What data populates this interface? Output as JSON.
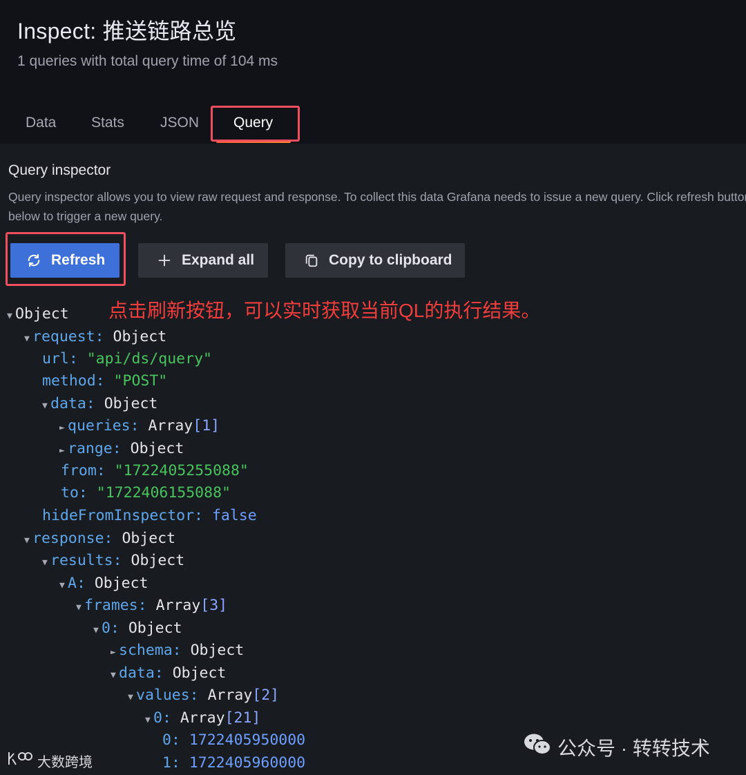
{
  "header": {
    "title": "Inspect: 推送链路总览",
    "subtitle": "1 queries with total query time of 104 ms"
  },
  "tabs": [
    {
      "label": "Data",
      "active": false
    },
    {
      "label": "Stats",
      "active": false
    },
    {
      "label": "JSON",
      "active": false
    },
    {
      "label": "Query",
      "active": true
    }
  ],
  "inspector": {
    "title": "Query inspector",
    "description": "Query inspector allows you to view raw request and response. To collect this data Grafana needs to issue a new query. Click refresh button below to trigger a new query.",
    "buttons": {
      "refresh": "Refresh",
      "expand_all": "Expand all",
      "copy": "Copy to clipboard"
    }
  },
  "annotation": "点击刷新按钮，可以实时获取当前QL的执行结果。",
  "tree": {
    "root": "Object",
    "request_key": "request:",
    "request_val": "Object",
    "url_key": "url:",
    "url_val": "\"api/ds/query\"",
    "method_key": "method:",
    "method_val": "\"POST\"",
    "data_key": "data:",
    "data_val": "Object",
    "queries_key": "queries:",
    "queries_val": "Array",
    "queries_len": "[1]",
    "range_key": "range:",
    "range_val": "Object",
    "from_key": "from:",
    "from_val": "\"1722405255088\"",
    "to_key": "to:",
    "to_val": "\"1722406155088\"",
    "hide_key": "hideFromInspector:",
    "hide_val": "false",
    "response_key": "response:",
    "response_val": "Object",
    "results_key": "results:",
    "results_val": "Object",
    "a_key": "A:",
    "a_val": "Object",
    "frames_key": "frames:",
    "frames_val": "Array",
    "frames_len": "[3]",
    "frame0_key": "0:",
    "frame0_val": "Object",
    "schema_key": "schema:",
    "schema_val": "Object",
    "fdata_key": "data:",
    "fdata_val": "Object",
    "values_key": "values:",
    "values_val": "Array",
    "values_len": "[2]",
    "v0_key": "0:",
    "v0_val": "Array",
    "v0_len": "[21]",
    "item0_key": "0:",
    "item0_val": "1722405950000",
    "item1_key": "1:",
    "item1_val": "1722405960000"
  },
  "watermarks": {
    "left": "大数跨境",
    "right": "公众号 · 转转技术"
  },
  "icons": [
    "refresh-icon",
    "plus-icon",
    "copy-icon",
    "wechat-icon",
    "logo-icon"
  ]
}
